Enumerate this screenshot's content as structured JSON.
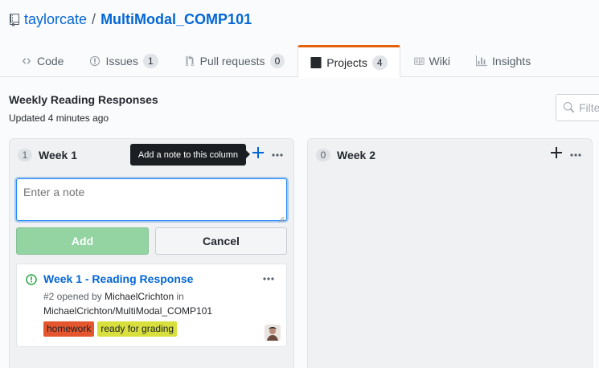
{
  "repo": {
    "owner": "taylorcate",
    "separator": "/",
    "name": "MultiModal_COMP101"
  },
  "tabs": [
    {
      "label": "Code",
      "icon": "code-icon"
    },
    {
      "label": "Issues",
      "icon": "issue-opened-icon",
      "count": "1"
    },
    {
      "label": "Pull requests",
      "icon": "git-pull-request-icon",
      "count": "0"
    },
    {
      "label": "Projects",
      "icon": "project-icon",
      "count": "4",
      "selected": true
    },
    {
      "label": "Wiki",
      "icon": "book-icon"
    },
    {
      "label": "Insights",
      "icon": "graph-icon"
    }
  ],
  "project": {
    "title": "Weekly Reading Responses",
    "updated": "Updated 4 minutes ago",
    "filter_placeholder": "Filte"
  },
  "columns": [
    {
      "count": "1",
      "name": "Week 1"
    },
    {
      "count": "0",
      "name": "Week 2"
    }
  ],
  "tooltip": "Add a note to this column",
  "note_form": {
    "placeholder": "Enter a note",
    "add_label": "Add",
    "cancel_label": "Cancel"
  },
  "card": {
    "title": "Week 1 - Reading Response",
    "number_text": "#2 opened by",
    "author": "MichaelCrichton",
    "in_text": "in",
    "repo": "MichaelCrichton/MultiModal_COMP101",
    "labels": [
      {
        "name": "homework",
        "color": "#e4572e"
      },
      {
        "name": "ready for grading",
        "color": "#d9e03d"
      }
    ]
  },
  "colors": {
    "link": "#0366d6",
    "tab_accent": "#e36209",
    "add_button_disabled": "#94d3a2",
    "open_issue": "#28a745"
  }
}
